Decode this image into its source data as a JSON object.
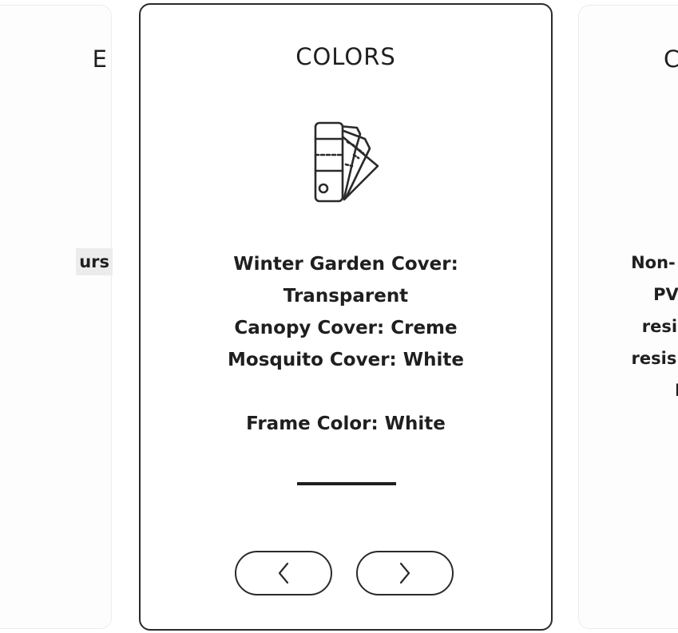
{
  "left_card": {
    "title": "E",
    "text": "urs"
  },
  "main_card": {
    "title": "COLORS",
    "icon": "color-swatch-fan-icon",
    "lines": [
      "Winter Garden Cover:",
      "Transparent",
      "Canopy Cover: Creme",
      "Mosquito Cover: White"
    ],
    "frame_color": "Frame Color: White",
    "prev_icon": "chevron-left-icon",
    "next_icon": "chevron-right-icon"
  },
  "right_card": {
    "title": "C",
    "lines": [
      "Non-",
      "PV",
      "resi",
      "resis",
      "I"
    ]
  },
  "colors": {
    "text": "#1f1f1f",
    "border": "#2a2a2a",
    "side_border": "#ececf0",
    "background": "#ffffff"
  }
}
